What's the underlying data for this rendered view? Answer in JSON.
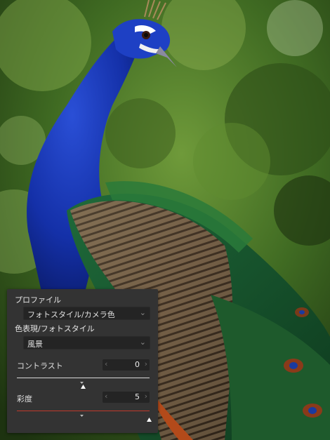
{
  "panel": {
    "profile_label": "プロファイル",
    "profile_value": "フォトスタイル/カメラ色",
    "style_label": "色表現/フォトスタイル",
    "style_value": "風景",
    "sliders": [
      {
        "label": "コントラスト",
        "value": "0",
        "level_percent": 50
      },
      {
        "label": "彩度",
        "value": "5",
        "level_percent": 100
      }
    ]
  },
  "colors": {
    "panel_bg": "#333333",
    "field_bg": "#242424",
    "text": "#e6e6e6",
    "saturation_track": "#c0392b"
  },
  "icons": {
    "dropdown": "chevron-down-icon",
    "decrement": "chevron-left-icon",
    "increment": "chevron-right-icon"
  }
}
